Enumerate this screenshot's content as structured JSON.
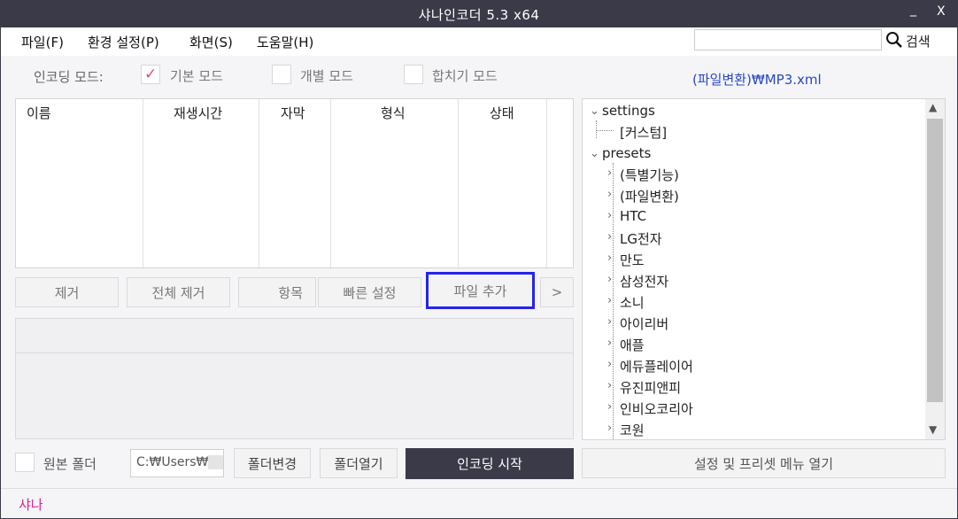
{
  "window": {
    "title": "샤나인코더  5.3  x64",
    "minimize": "_",
    "close": "X"
  },
  "menu": {
    "items": [
      "파일(F)",
      "환경 설정(P)",
      "화면(S)",
      "도움말(H)"
    ],
    "search_label": "검색",
    "search_value": ""
  },
  "mode": {
    "label": "인코딩 모드:",
    "basic": "기본 모드",
    "individual": "개별 모드",
    "merge": "합치기 모드",
    "checked": "basic",
    "preset_path": "(파일변환)₩MP3.xml"
  },
  "list": {
    "columns": [
      "이름",
      "재생시간",
      "자막",
      "형식",
      "상태"
    ]
  },
  "buttons": {
    "remove": "제거",
    "remove_all": "전체 제거",
    "items": "항목",
    "quick_settings": "빠른 설정",
    "add_file": "파일 추가",
    "more": ">"
  },
  "tree": {
    "settings": "settings",
    "custom": "[커스텀]",
    "presets": "presets",
    "preset_items": [
      "(특별기능)",
      "(파일변환)",
      "HTC",
      "LG전자",
      "만도",
      "삼성전자",
      "소니",
      "아이리버",
      "애플",
      "에듀플레이어",
      "유진피앤피",
      "인비오코리아",
      "코원"
    ]
  },
  "bottom": {
    "source_folder": "원본 폴더",
    "folder_path": "C:₩Users₩",
    "change_folder": "폴더변경",
    "open_folder": "폴더열기",
    "start_encoding": "인코딩 시작",
    "open_preset_menu": "설정 및 프리셋 메뉴 열기"
  },
  "status": {
    "text": "샤나"
  },
  "colors": {
    "titlebar": "#3a3a48",
    "accent_pink": "#e0209a",
    "highlight_blue": "#2424ee",
    "path_blue": "#2a48c8"
  }
}
